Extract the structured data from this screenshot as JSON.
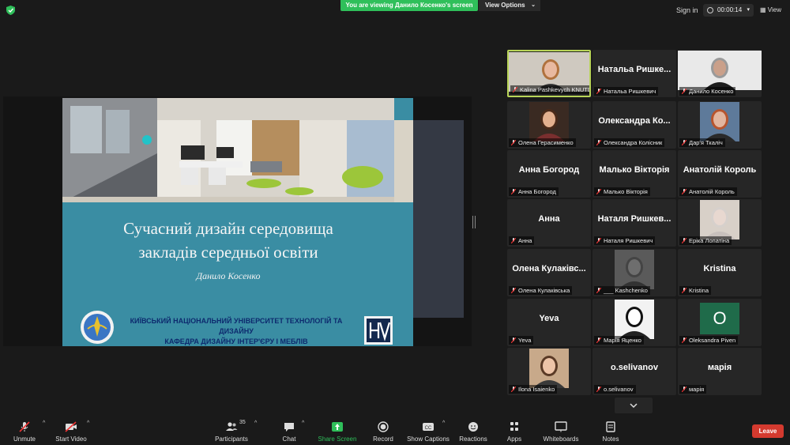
{
  "topbar": {
    "viewing_banner": "You are viewing Данило Косенко's screen",
    "view_options_label": "View Options",
    "sign_in_label": "Sign in",
    "timer": "00:00:14",
    "view_label": "View"
  },
  "slide": {
    "title_line1": "Сучасний дизайн середовища",
    "title_line2": "закладів середньої освіти",
    "author": "Данило Косенко",
    "university_line1": "КИЇВСЬКИЙ НАЦІОНАЛЬНИЙ УНІВЕРСИТЕТ ТЕХНОЛОГІЙ ТА ДИЗАЙНУ",
    "university_line2": "КАФЕДРА ДИЗАЙНУ ІНТЕР'ЄРУ І МЕБЛІВ"
  },
  "participants_tiles": [
    {
      "big": "",
      "label": "Kalina Pashkevych KNUTD...",
      "active": true
    },
    {
      "big": "Натальа Ришке...",
      "label": "Натальа Ришкевич"
    },
    {
      "big": "",
      "label": "Данило Косенко"
    },
    {
      "big": "",
      "label": "Олена Герасименко"
    },
    {
      "big": "Олександра Ко...",
      "label": "Олександра Колісник"
    },
    {
      "big": "",
      "label": "Дар'я Ткаліч"
    },
    {
      "big": "Анна Богород",
      "label": "Анна Богород"
    },
    {
      "big": "Малько Вікторія",
      "label": "Малько Вікторія"
    },
    {
      "big": "Анатолій Король",
      "label": "Анатолій Король"
    },
    {
      "big": "Анна",
      "label": "Анна"
    },
    {
      "big": "Наталя Ришкев...",
      "label": "Наталя Ришкевич"
    },
    {
      "big": "",
      "label": "Еріка Лопатіна"
    },
    {
      "big": "Олена Кулаківс...",
      "label": "Олена Кулаківська"
    },
    {
      "big": "",
      "label": "___ Kashchenko"
    },
    {
      "big": "Kristina",
      "label": "Kristina"
    },
    {
      "big": "Yeva",
      "label": "Yeva"
    },
    {
      "big": "",
      "label": "Марія Яценко"
    },
    {
      "big": "",
      "label": "Oleksandra Piven",
      "avatar_letter": "O"
    },
    {
      "big": "",
      "label": "Ilona Isaienko"
    },
    {
      "big": "o.selivanov",
      "label": "o.selivanov"
    },
    {
      "big": "марія",
      "label": "марія"
    }
  ],
  "toolbar": {
    "unmute": "Unmute",
    "start_video": "Start Video",
    "participants": "Participants",
    "participants_count": "35",
    "chat": "Chat",
    "share_screen": "Share Screen",
    "record": "Record",
    "show_captions": "Show Captions",
    "reactions": "Reactions",
    "apps": "Apps",
    "whiteboards": "Whiteboards",
    "notes": "Notes",
    "leave": "Leave"
  },
  "colors": {
    "share_green": "#2fbf5a",
    "leave_red": "#d43a2f",
    "active_speaker_border": "#b8d458",
    "slide_teal": "#3a8da3"
  }
}
